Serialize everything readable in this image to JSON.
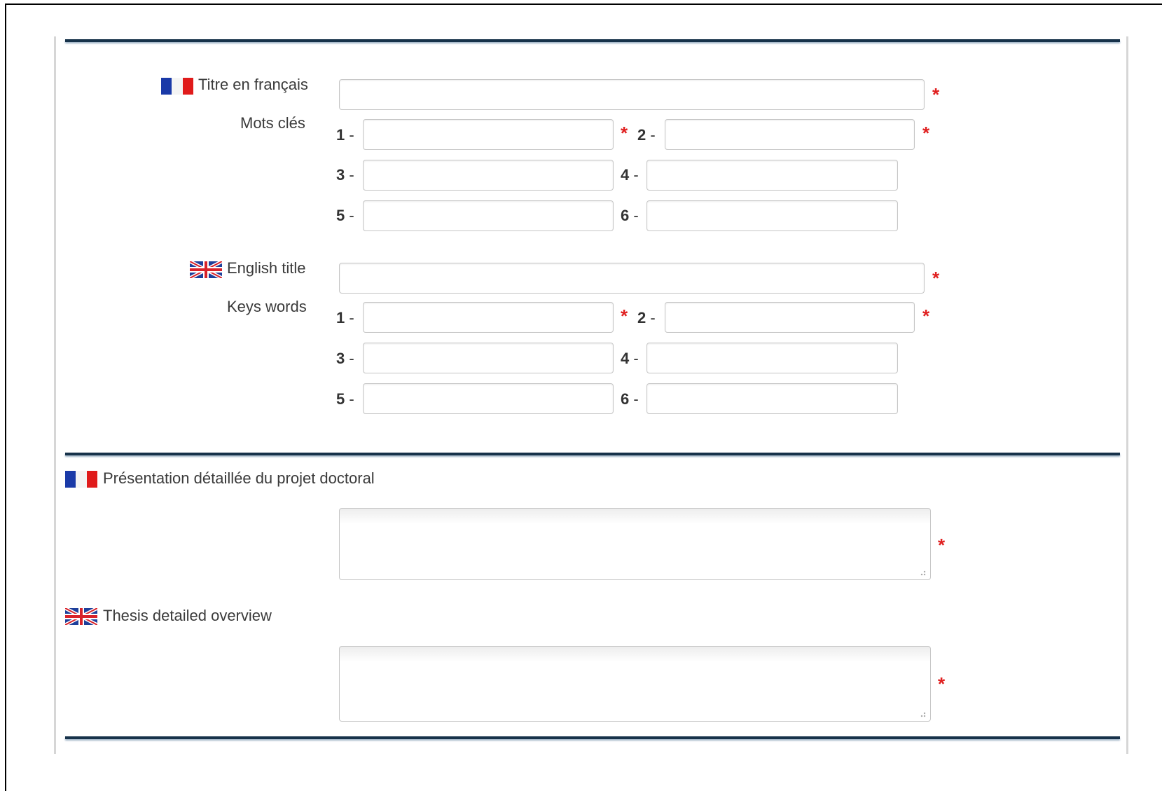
{
  "section1": {
    "fr_title_label": "Titre en français",
    "fr_keywords_label": "Mots clés",
    "en_title_label": "English title",
    "en_keywords_label": "Keys words",
    "keyword_numbers": [
      "1",
      "2",
      "3",
      "4",
      "5",
      "6"
    ],
    "separator": "-",
    "required_mark": "*"
  },
  "section2": {
    "fr_presentation_label": "Présentation détaillée du projet doctoral",
    "en_overview_label": "Thesis detailed overview"
  },
  "icons": {
    "fr_flag": "france-flag-icon",
    "uk_flag": "uk-flag-icon",
    "resize": "resize-grip-icon"
  },
  "colors": {
    "rule": "#17324a",
    "required": "#e02020",
    "input_border": "#c6c6c6"
  }
}
